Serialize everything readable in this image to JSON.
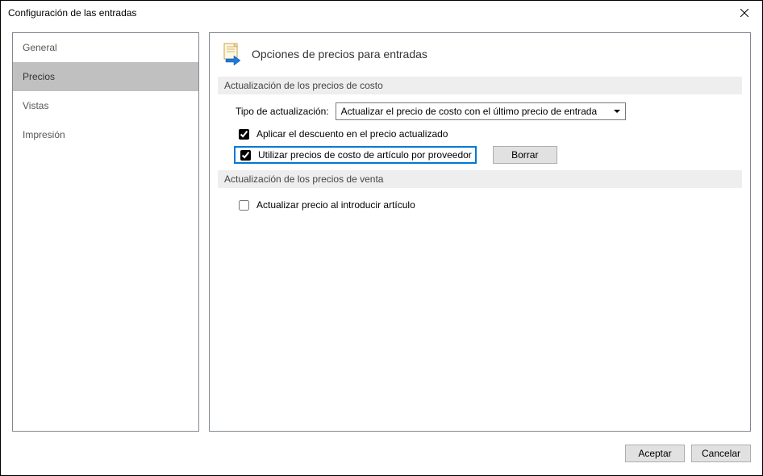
{
  "window": {
    "title": "Configuración de las entradas"
  },
  "sidebar": {
    "items": [
      {
        "label": "General"
      },
      {
        "label": "Precios"
      },
      {
        "label": "Vistas"
      },
      {
        "label": "Impresión"
      }
    ]
  },
  "main": {
    "page_title": "Opciones de precios para entradas",
    "section1": {
      "title": "Actualización de los precios de costo",
      "update_type_label": "Tipo de actualización:",
      "update_type_value": "Actualizar el precio de costo con el último precio de entrada",
      "apply_discount_label": "Aplicar el descuento en el precio actualizado",
      "use_supplier_cost_label": "Utilizar precios de costo de artículo por proveedor",
      "clear_button": "Borrar"
    },
    "section2": {
      "title": "Actualización de los precios de venta",
      "update_on_insert_label": "Actualizar precio al introducir artículo"
    }
  },
  "footer": {
    "accept": "Aceptar",
    "cancel": "Cancelar"
  }
}
